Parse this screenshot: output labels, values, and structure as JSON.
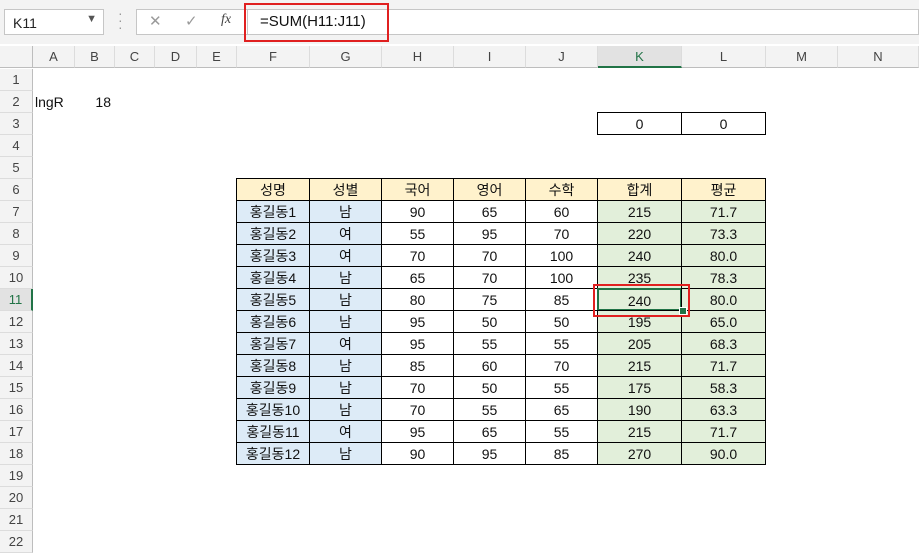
{
  "name_box": {
    "value": "K11"
  },
  "formula_bar": {
    "cancel_icon": "✕",
    "enter_icon": "✓",
    "fx_label": "fx",
    "formula": "=SUM(H11:J11)"
  },
  "columns": [
    "A",
    "B",
    "C",
    "D",
    "E",
    "F",
    "G",
    "H",
    "I",
    "J",
    "K",
    "L",
    "M",
    "N"
  ],
  "rows": [
    "1",
    "2",
    "3",
    "4",
    "5",
    "6",
    "7",
    "8",
    "9",
    "10",
    "11",
    "12",
    "13",
    "14",
    "15",
    "16",
    "17",
    "18",
    "19",
    "20",
    "21",
    "22"
  ],
  "cells": {
    "A2": "lngR",
    "B2": "18",
    "K3": "0",
    "L3": "0"
  },
  "table": {
    "headers": [
      "성명",
      "성별",
      "국어",
      "영어",
      "수학",
      "합계",
      "평균"
    ],
    "rows": [
      [
        "홍길동1",
        "남",
        "90",
        "65",
        "60",
        "215",
        "71.7"
      ],
      [
        "홍길동2",
        "여",
        "55",
        "95",
        "70",
        "220",
        "73.3"
      ],
      [
        "홍길동3",
        "여",
        "70",
        "70",
        "100",
        "240",
        "80.0"
      ],
      [
        "홍길동4",
        "남",
        "65",
        "70",
        "100",
        "235",
        "78.3"
      ],
      [
        "홍길동5",
        "남",
        "80",
        "75",
        "85",
        "240",
        "80.0"
      ],
      [
        "홍길동6",
        "남",
        "95",
        "50",
        "50",
        "195",
        "65.0"
      ],
      [
        "홍길동7",
        "여",
        "95",
        "55",
        "55",
        "205",
        "68.3"
      ],
      [
        "홍길동8",
        "남",
        "85",
        "60",
        "70",
        "215",
        "71.7"
      ],
      [
        "홍길동9",
        "남",
        "70",
        "50",
        "55",
        "175",
        "58.3"
      ],
      [
        "홍길동10",
        "남",
        "70",
        "55",
        "65",
        "190",
        "63.3"
      ],
      [
        "홍길동11",
        "여",
        "95",
        "65",
        "55",
        "215",
        "71.7"
      ],
      [
        "홍길동12",
        "남",
        "90",
        "95",
        "85",
        "270",
        "90.0"
      ]
    ]
  },
  "selection": {
    "column": "K",
    "row": "11"
  },
  "colors": {
    "header_fill": "#fff2cc",
    "gender_fill": "#ddebf7",
    "sum_fill": "#e2efda",
    "highlight": "#e02020",
    "accent": "#217346"
  }
}
